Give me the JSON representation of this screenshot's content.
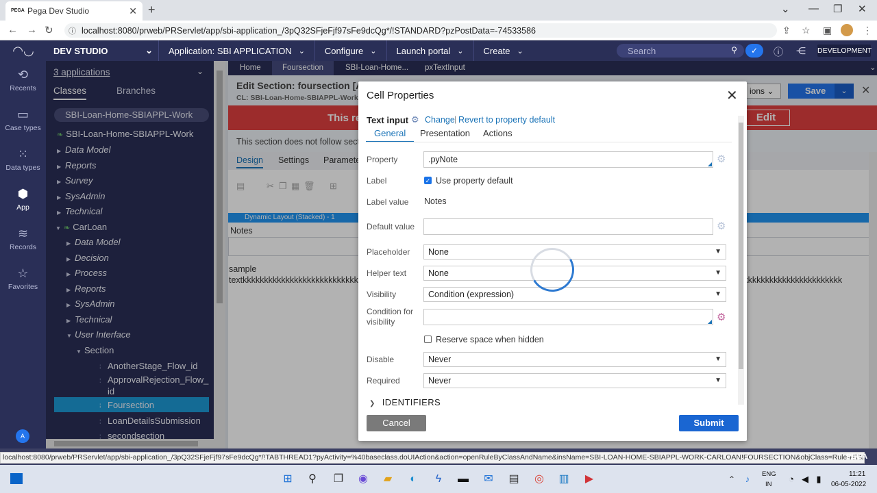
{
  "browser": {
    "tab_title": "Pega Dev Studio",
    "favicon_text": "PEGA",
    "url": "localhost:8080/prweb/PRServlet/app/sbi-application_/3pQ32SFjeFjf97sFe9dcQg*/!STANDARD?pzPostData=-74533586"
  },
  "pega": {
    "studio": "DEV STUDIO",
    "application_label": "Application:",
    "application_name": "SBI APPLICATION",
    "menus": [
      "Configure",
      "Launch portal",
      "Create"
    ],
    "search_placeholder": "Search",
    "env_badge": "DEVELOPMENT"
  },
  "rail": {
    "items": [
      {
        "label": "Recents",
        "icon": "history-icon"
      },
      {
        "label": "Case types",
        "icon": "case-types-icon"
      },
      {
        "label": "Data types",
        "icon": "data-types-icon"
      },
      {
        "label": "App",
        "icon": "app-cube-icon"
      },
      {
        "label": "Records",
        "icon": "records-stack-icon"
      },
      {
        "label": "Favorites",
        "icon": "star-icon"
      }
    ],
    "avatar_initial": "A"
  },
  "explorer": {
    "apps_count": "3 applications",
    "tabs": [
      "Classes",
      "Branches"
    ],
    "class_filter": "SBI-Loan-Home-SBIAPPL-Work",
    "tree": [
      "SBI-Loan-Home-SBIAPPL-Work",
      "Data Model",
      "Reports",
      "Survey",
      "SysAdmin",
      "Technical",
      "CarLoan",
      "Data Model",
      "Decision",
      "Process",
      "Reports",
      "SysAdmin",
      "Technical",
      "User Interface",
      "Section",
      "AnotherStage_Flow_id",
      "ApprovalRejection_Flow_",
      "id",
      "Foursection",
      "LoanDetailsSubmission",
      "secondsection"
    ]
  },
  "workspace": {
    "tabs": [
      "Home",
      "Foursection",
      "SBI-Loan-Home...",
      "pxTextInput"
    ],
    "title": "Edit  Section: foursection [Ava",
    "class_line": "CL:  SBI-Loan-Home-SBIAPPL-Work",
    "actions_label": "ions",
    "save_label": "Save",
    "banner_text": "This re",
    "banner_button": "Edit",
    "guardrail_text": "This section does not follow secti",
    "subtabs": [
      "Design",
      "Settings",
      "Paramete"
    ],
    "dynamic_layout": "Dynamic Layout (Stacked) -    1",
    "field_label": "Notes",
    "sample_line1": "sample",
    "sample_line2": "textkkkkkkkkkkkkkkkkkkkkkkkkkkkkkkkkkkkkkkkkkkkkkkkkkkkkkkkkkkkkkkkkkkkkkkkkkkkkkkkkkkkkkkkkkkkkkkkkkkkkkkkkkkkkkkkkkkkkkkkkkkkkkkkkkkkkkkkkkkkk"
  },
  "modal": {
    "title": "Cell Properties",
    "control_type": "Text input",
    "change_link": "Change",
    "separator": "|",
    "revert_link": "Revert to property default",
    "tabs": [
      "General",
      "Presentation",
      "Actions"
    ],
    "fields": {
      "property_label": "Property",
      "property_value": ".pyNote",
      "label_label": "Label",
      "use_default": "Use property default",
      "label_value_label": "Label value",
      "label_value": "Notes",
      "default_value_label": "Default value",
      "default_value": "",
      "placeholder_label": "Placeholder",
      "placeholder_value": "None",
      "helper_label": "Helper text",
      "helper_value": "None",
      "visibility_label": "Visibility",
      "visibility_value": "Condition (expression)",
      "condition_label_1": "Condition for",
      "condition_label_2": "visibility",
      "condition_value": "",
      "reserve_space": "Reserve space when hidden",
      "disable_label": "Disable",
      "disable_value": "Never",
      "required_label": "Required",
      "required_value": "Never"
    },
    "section_identifiers": "IDENTIFIERS",
    "cancel": "Cancel",
    "submit": "Submit"
  },
  "status": {
    "url": "localhost:8080/prweb/PRServlet/app/sbi-application_/3pQ32SFjeFjf97sFe9dcQg*/!TABTHREAD1?pyActivity=%40baseclass.doUIAction&action=openRuleByClassAndName&insName=SBI-LOAN-HOME-SBIAPPL-WORK-CARLOAN!FOURSECTION&objClass=Rule-HTML-Section&Forma...",
    "brand": "PEGA"
  },
  "taskbar": {
    "lang1": "ENG",
    "lang2": "IN",
    "time": "11:21",
    "date": "06-05-2022"
  },
  "colors": {
    "pega_navy": "#2a2f57",
    "accent_blue": "#1a73b7",
    "submit_blue": "#1a66d2",
    "banner_red": "#e03f3f",
    "selected_tree": "#1e9ad6"
  }
}
